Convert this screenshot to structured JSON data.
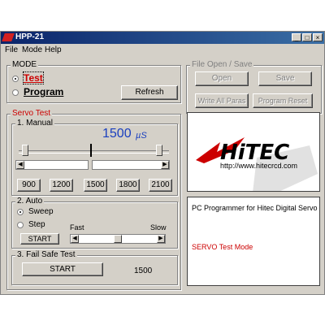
{
  "window": {
    "title": "HPP-21",
    "controls": {
      "minimize": "_",
      "maximize": "□",
      "close": "×"
    }
  },
  "menu": [
    "File",
    "Mode",
    "Help"
  ],
  "mode": {
    "legend": "MODE",
    "options": [
      "Test",
      "Program"
    ],
    "selected": "Test",
    "refresh_label": "Refresh"
  },
  "file_group": {
    "legend": "File Open / Save",
    "buttons": [
      "Open",
      "Save",
      "Write All Paras",
      "Program Reset"
    ]
  },
  "servo_test": {
    "legend": "Servo Test",
    "manual": {
      "legend": "1. Manual",
      "value": "1500",
      "unit": "µS",
      "presets": [
        "900",
        "1200",
        "1500",
        "1800",
        "2100"
      ]
    },
    "auto": {
      "legend": "2. Auto",
      "options": [
        "Sweep",
        "Step"
      ],
      "selected": "Sweep",
      "fast_label": "Fast",
      "slow_label": "Slow",
      "start_label": "START",
      "speed_fraction": 0.5
    },
    "failsafe": {
      "legend": "3. Fail Safe Test",
      "start_label": "START",
      "value": "1500"
    }
  },
  "logo": {
    "brand": "HiTEC",
    "url": "http://www.hitecrcd.com"
  },
  "status": {
    "title": "PC Programmer for Hitec Digital Servo",
    "mode_text": "SERVO Test Mode",
    "colors": {
      "title": "#000000",
      "mode": "#cc0000"
    }
  }
}
